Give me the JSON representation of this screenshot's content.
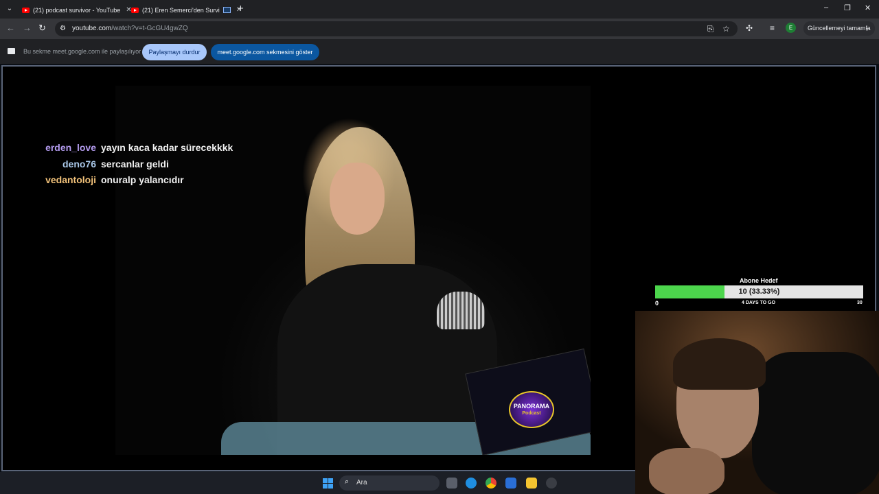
{
  "tabs": [
    {
      "title": "(21) podcast survivor - YouTube"
    },
    {
      "title": "(21) Eren Semerci'den Survi"
    }
  ],
  "toolbar": {
    "url_host": "youtube.com",
    "url_path": "/watch?v=t-GcGU4gwZQ",
    "profile_initial": "E",
    "update_label": "Güncellemeyi tamamla"
  },
  "sharebar": {
    "message": "Bu sekme meet.google.com ile paylaşılıyor",
    "stop_label": "Paylaşmayı durdur",
    "show_label": "meet.google.com sekmesini göster"
  },
  "chat": [
    {
      "user": "erden_love",
      "message": "yayın kaca kadar sürecekkkk",
      "color": "#b49cf0"
    },
    {
      "user": "deno76",
      "message": "sercanlar geldi",
      "color": "#a9c7e8"
    },
    {
      "user": "vedantoloji",
      "message": "onuralp yalancıdır",
      "color": "#f2c27a"
    }
  ],
  "video": {
    "logo_text": "PANORAMA",
    "logo_subtext": "Podcast"
  },
  "goal": {
    "title": "Abone Hedef",
    "progress_text": "10 (33.33%)",
    "fraction": 0.3333,
    "min": "0",
    "max": "30",
    "days_text": "4 DAYS TO GO"
  },
  "taskbar": {
    "search_label": "Ara"
  },
  "icons": {
    "back": "arrow-left-icon",
    "forward": "arrow-right-icon",
    "reload": "reload-icon",
    "bookmark": "star-icon"
  }
}
